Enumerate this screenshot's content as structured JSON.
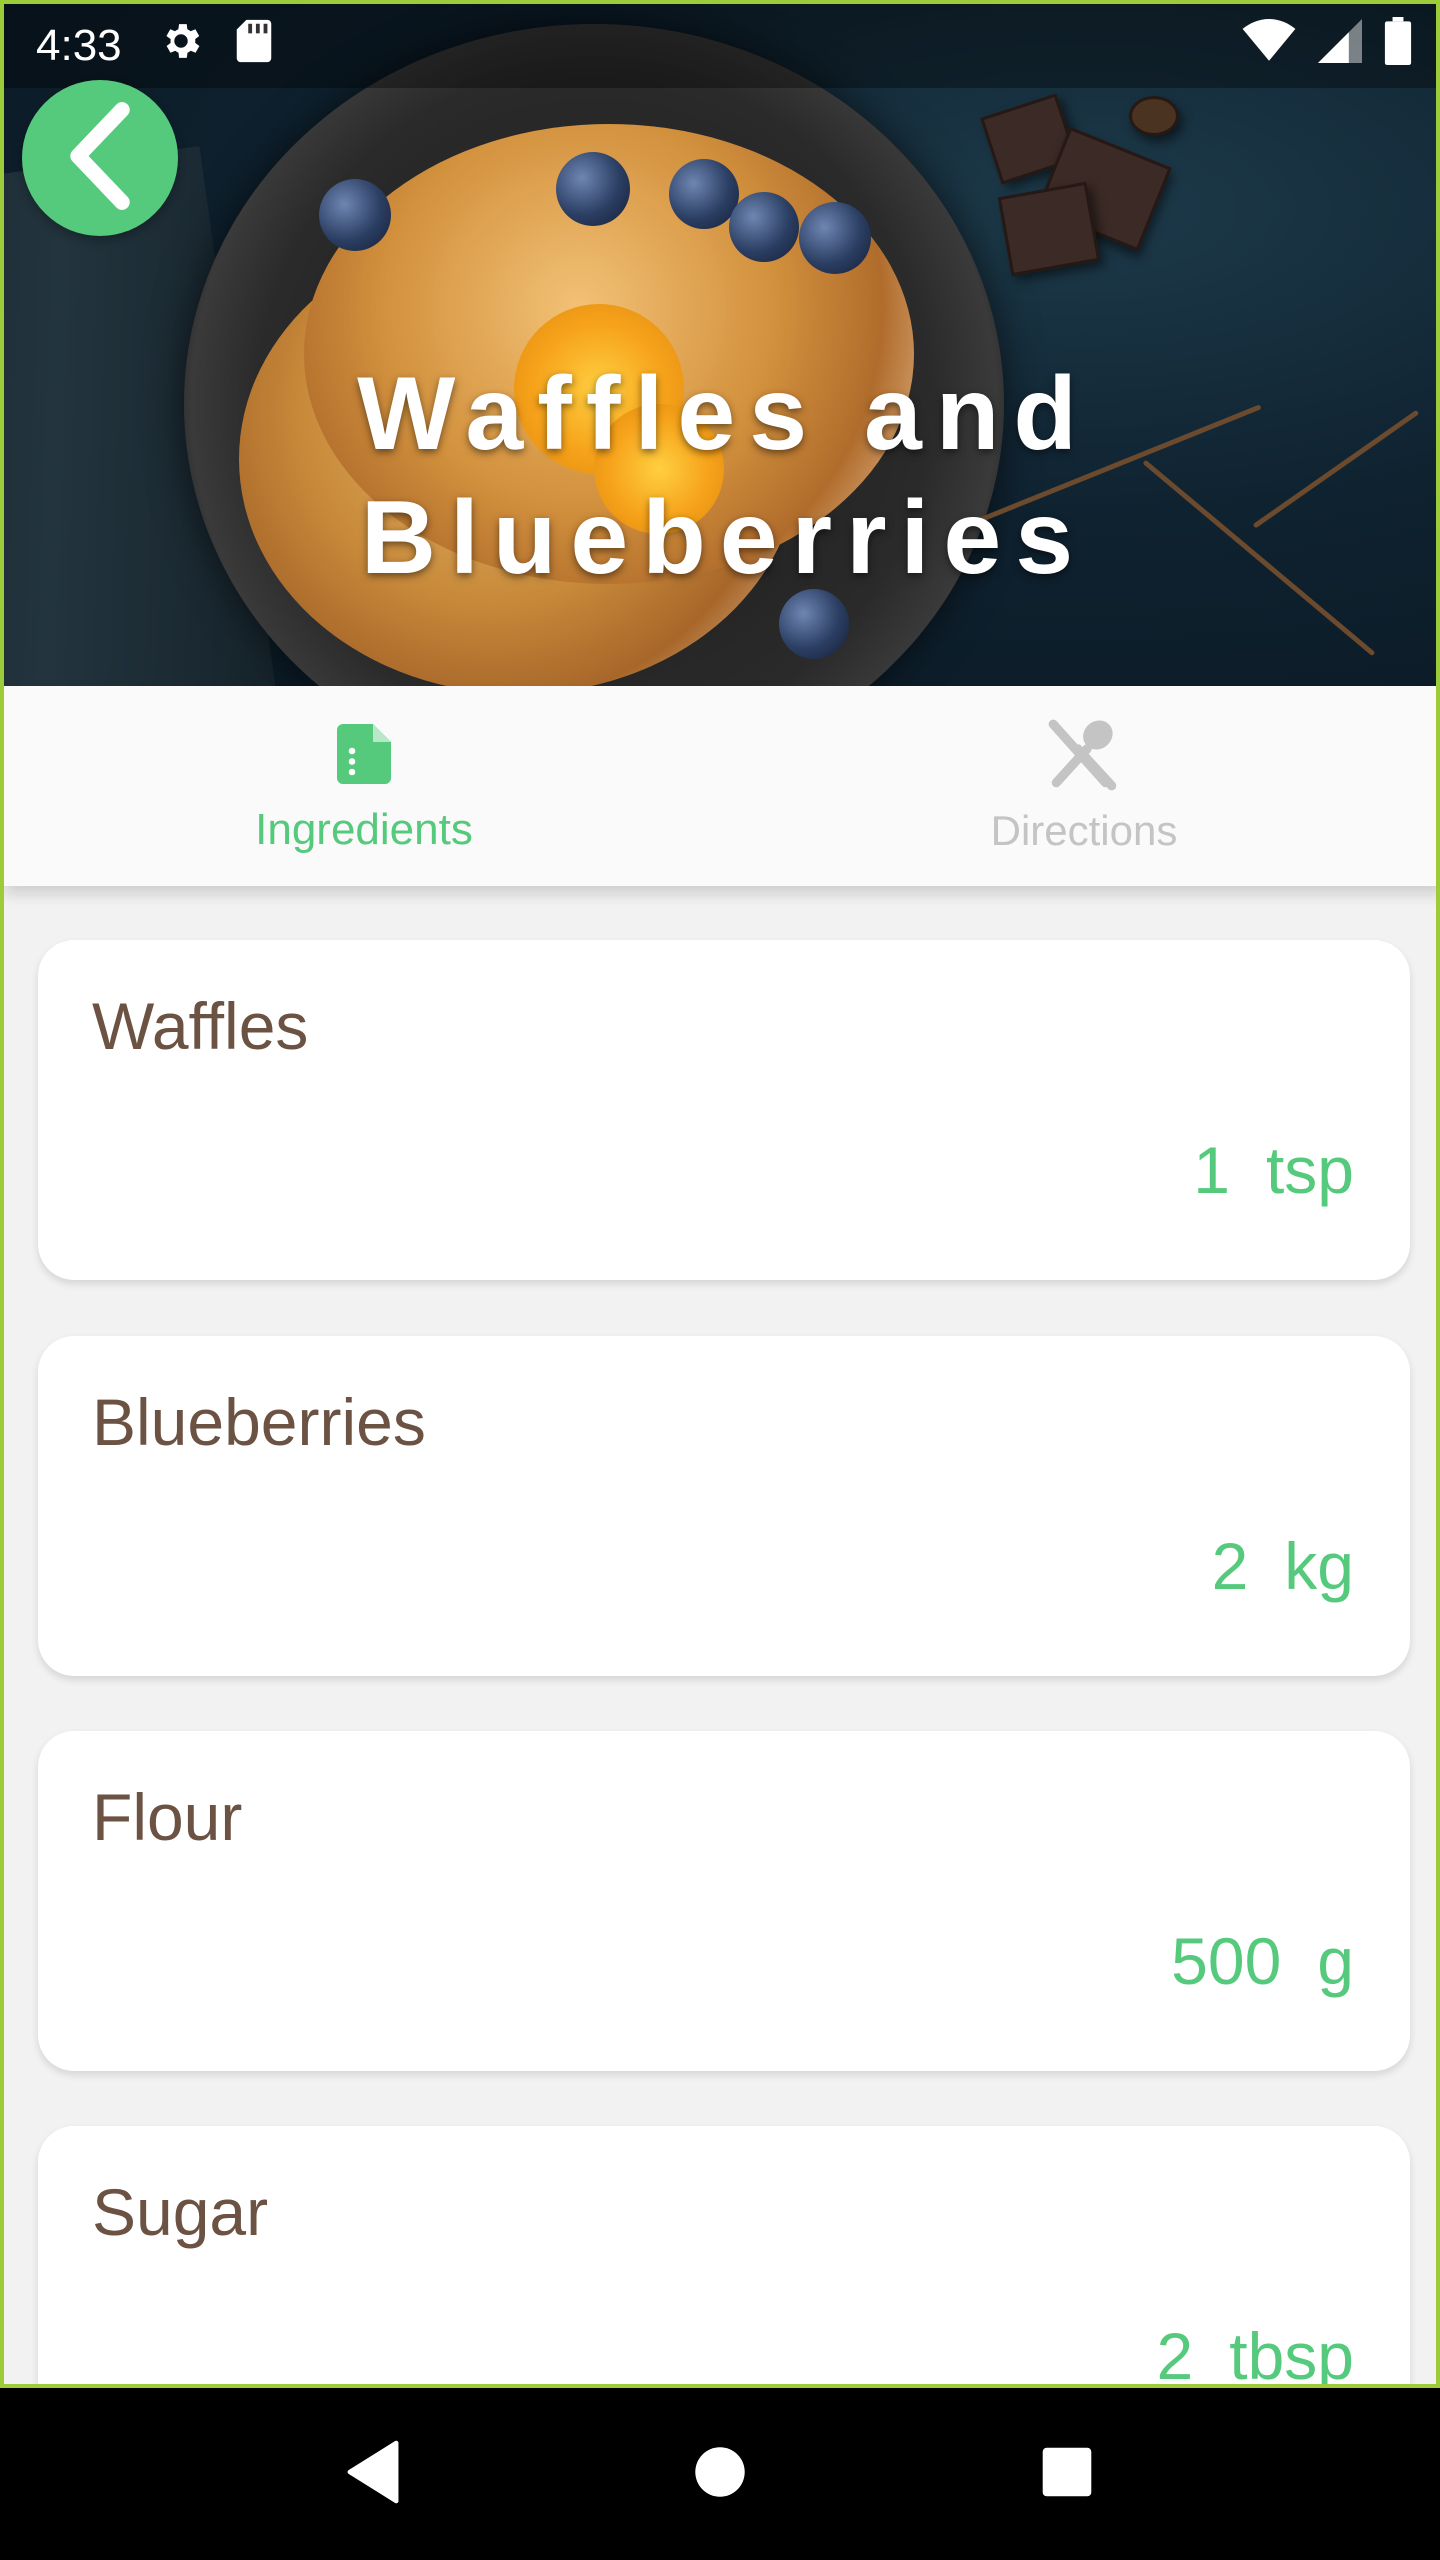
{
  "status_bar": {
    "time": "4:33"
  },
  "recipe": {
    "title_line1": "Waffles and",
    "title_line2": "Blueberries"
  },
  "tabs": [
    {
      "label": "Ingredients",
      "icon": "document-icon",
      "active": true
    },
    {
      "label": "Directions",
      "icon": "utensils-icon",
      "active": false
    }
  ],
  "ingredients": [
    {
      "name": "Waffles",
      "amount": "1",
      "unit": "tsp"
    },
    {
      "name": "Blueberries",
      "amount": "2",
      "unit": "kg"
    },
    {
      "name": "Flour",
      "amount": "500",
      "unit": "g"
    },
    {
      "name": "Sugar",
      "amount": "2",
      "unit": "tbsp"
    }
  ],
  "colors": {
    "accent": "#55c97c",
    "ingredient_name": "#6b5242",
    "inactive_tab": "#c4c4c4",
    "frame": "#9ccc3a"
  }
}
